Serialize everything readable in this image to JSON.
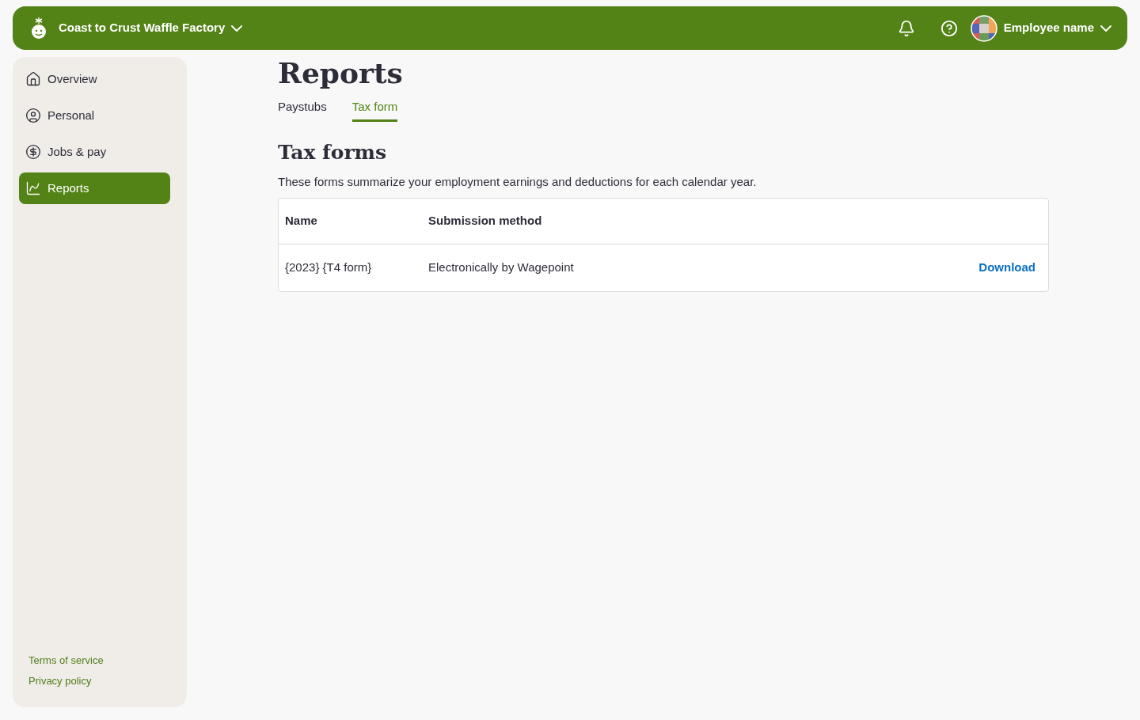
{
  "header": {
    "company": "Coast to Crust Waffle Factory",
    "user": "Employee name"
  },
  "sidebar": {
    "items": [
      {
        "label": "Overview",
        "kind": "home",
        "selected": false
      },
      {
        "label": "Personal",
        "kind": "person",
        "selected": false
      },
      {
        "label": "Jobs & pay",
        "kind": "dollar",
        "selected": false
      },
      {
        "label": "Reports",
        "kind": "report",
        "selected": true
      }
    ],
    "footer_links": [
      "Terms of service",
      "Privacy policy"
    ]
  },
  "page": {
    "title": "Reports",
    "tabs": [
      {
        "label": "Paystubs",
        "selected": false
      },
      {
        "label": "Tax form",
        "selected": true
      }
    ],
    "section_title": "Tax forms",
    "description": "These forms summarize your employment earnings and deductions for each calendar year.",
    "table": {
      "columns": [
        "Name",
        "Submission method"
      ],
      "rows": [
        {
          "name": "{2023} {T4 form}",
          "method": "Electronically by Wagepoint",
          "action": "Download"
        }
      ]
    }
  }
}
